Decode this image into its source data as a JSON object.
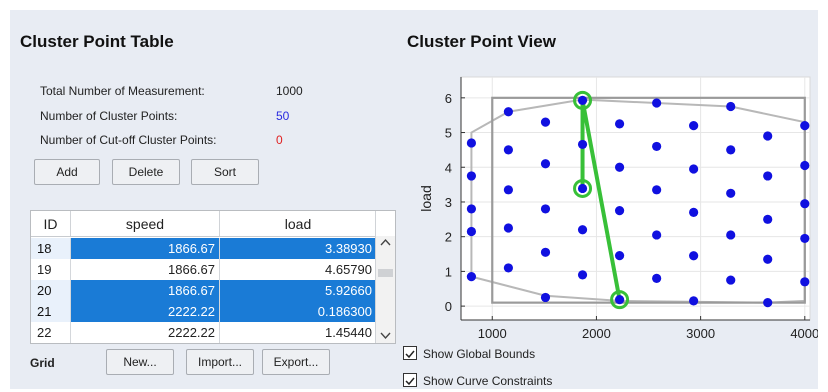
{
  "table_panel": {
    "title": "Cluster Point Table",
    "stats": [
      {
        "label": "Total Number of Measurement:",
        "value": "1000",
        "color": "#222222"
      },
      {
        "label": "Number of Cluster Points:",
        "value": "50",
        "color": "#2a2ae0"
      },
      {
        "label": "Number of Cut-off Cluster Points:",
        "value": "0",
        "color": "#e02020"
      }
    ],
    "buttons": {
      "add": "Add",
      "delete": "Delete",
      "sort": "Sort"
    },
    "columns": [
      "ID",
      "speed",
      "load"
    ],
    "rows": [
      {
        "id": "18",
        "speed": "1866.67",
        "load": "3.38930",
        "selected": true
      },
      {
        "id": "19",
        "speed": "1866.67",
        "load": "4.65790",
        "selected": false
      },
      {
        "id": "20",
        "speed": "1866.67",
        "load": "5.92660",
        "selected": true
      },
      {
        "id": "21",
        "speed": "2222.22",
        "load": "0.186300",
        "selected": true
      },
      {
        "id": "22",
        "speed": "2222.22",
        "load": "1.45440",
        "selected": false
      }
    ],
    "grid_label": "Grid",
    "grid_buttons": {
      "new": "New...",
      "import": "Import...",
      "export": "Export..."
    }
  },
  "view_panel": {
    "title": "Cluster Point View",
    "checkboxes": [
      {
        "label": "Show Global Bounds",
        "checked": true
      },
      {
        "label": "Show Curve Constraints",
        "checked": true
      }
    ]
  },
  "chart_data": {
    "type": "scatter",
    "title": "",
    "xlabel": "",
    "ylabel": "load",
    "xlim": [
      700,
      4050
    ],
    "ylim": [
      -0.4,
      6.6
    ],
    "xticks": [
      1000,
      2000,
      3000,
      4000
    ],
    "yticks": [
      0,
      1,
      2,
      3,
      4,
      5,
      6
    ],
    "grid": true,
    "point_color": "#1010e0",
    "points": [
      [
        800,
        0.85
      ],
      [
        800,
        2.15
      ],
      [
        800,
        2.8
      ],
      [
        800,
        3.75
      ],
      [
        800,
        4.7
      ],
      [
        1155,
        1.1
      ],
      [
        1155,
        2.25
      ],
      [
        1155,
        3.35
      ],
      [
        1155,
        4.5
      ],
      [
        1155,
        5.6
      ],
      [
        1511,
        0.25
      ],
      [
        1511,
        1.55
      ],
      [
        1511,
        2.8
      ],
      [
        1511,
        4.1
      ],
      [
        1511,
        5.3
      ],
      [
        1866.67,
        0.9
      ],
      [
        1866.67,
        2.2
      ],
      [
        1866.67,
        3.3893
      ],
      [
        1866.67,
        4.6579
      ],
      [
        1866.67,
        5.9266
      ],
      [
        2222.22,
        0.1863
      ],
      [
        2222.22,
        1.4544
      ],
      [
        2222.22,
        2.75
      ],
      [
        2222.22,
        4.0
      ],
      [
        2222.22,
        5.25
      ],
      [
        2578,
        0.8
      ],
      [
        2578,
        2.05
      ],
      [
        2578,
        3.35
      ],
      [
        2578,
        4.6
      ],
      [
        2578,
        5.85
      ],
      [
        2933,
        0.15
      ],
      [
        2933,
        1.45
      ],
      [
        2933,
        2.7
      ],
      [
        2933,
        3.95
      ],
      [
        2933,
        5.2
      ],
      [
        3289,
        0.75
      ],
      [
        3289,
        2.05
      ],
      [
        3289,
        3.25
      ],
      [
        3289,
        4.5
      ],
      [
        3289,
        5.75
      ],
      [
        3644,
        0.1
      ],
      [
        3644,
        1.35
      ],
      [
        3644,
        2.5
      ],
      [
        3644,
        3.75
      ],
      [
        3644,
        4.9
      ],
      [
        4000,
        0.7
      ],
      [
        4000,
        1.95
      ],
      [
        4000,
        2.95
      ],
      [
        4000,
        4.05
      ],
      [
        4000,
        5.2
      ]
    ],
    "global_bounds": {
      "x": [
        1000,
        4000
      ],
      "y": [
        0.1,
        6.0
      ]
    },
    "curve_constraint": [
      [
        800,
        0.85
      ],
      [
        1511,
        0.3
      ],
      [
        2222,
        0.15
      ],
      [
        3644,
        0.1
      ],
      [
        4000,
        0.15
      ],
      [
        4000,
        5.3
      ],
      [
        3289,
        5.75
      ],
      [
        1866.67,
        5.95
      ],
      [
        1155,
        5.6
      ],
      [
        800,
        5.0
      ]
    ],
    "selected_points": [
      [
        1866.67,
        3.3893
      ],
      [
        1866.67,
        5.9266
      ],
      [
        2222.22,
        0.1863
      ]
    ],
    "selection_color": "#38c038"
  }
}
